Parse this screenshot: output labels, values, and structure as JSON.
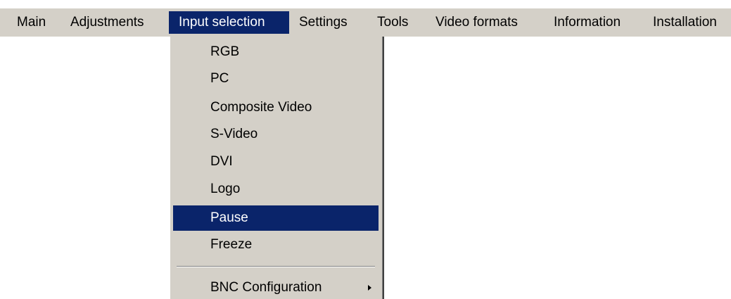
{
  "menubar": {
    "items": [
      {
        "label": "Main"
      },
      {
        "label": "Adjustments"
      },
      {
        "label": "Input selection",
        "active": true
      },
      {
        "label": "Settings"
      },
      {
        "label": "Tools"
      },
      {
        "label": "Video formats"
      },
      {
        "label": "Information"
      },
      {
        "label": "Installation"
      }
    ]
  },
  "dropdown": {
    "items": [
      {
        "label": "RGB"
      },
      {
        "label": "PC"
      },
      {
        "label": "Composite Video"
      },
      {
        "label": "S-Video"
      },
      {
        "label": "DVI"
      },
      {
        "label": "Logo"
      },
      {
        "label": "Pause",
        "selected": true
      },
      {
        "label": "Freeze"
      }
    ],
    "submenu": {
      "label": "BNC Configuration",
      "icon": "chevron-right-icon"
    }
  },
  "colors": {
    "menu_background": "#d4d0c8",
    "highlight": "#0a246a",
    "highlight_text": "#ffffff"
  }
}
